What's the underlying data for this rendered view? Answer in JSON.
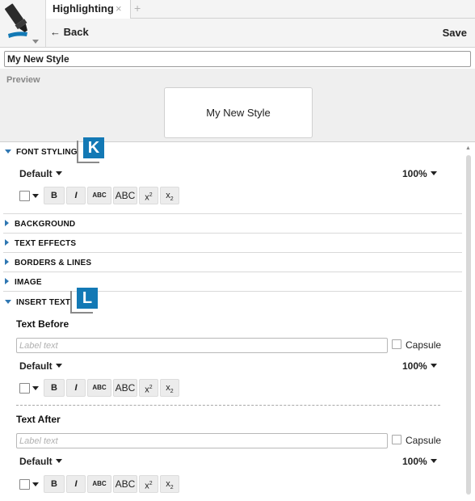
{
  "tabs": [
    {
      "label": "Highlighting",
      "close_glyph": "×"
    }
  ],
  "add_tab_glyph": "+",
  "toolbar": {
    "back_label": "Back",
    "back_glyph": "←",
    "save_label": "Save"
  },
  "style_name": "My New Style",
  "preview": {
    "label": "Preview",
    "text": "My New Style"
  },
  "sections": {
    "font_styling": "FONT STYLING",
    "background": "BACKGROUND",
    "text_effects": "TEXT EFFECTS",
    "borders_lines": "BORDERS & LINES",
    "image": "IMAGE",
    "insert_text": "INSERT TEXT"
  },
  "badges": {
    "k": "K",
    "l": "L"
  },
  "font_row": {
    "font": "Default",
    "size": "100%"
  },
  "format_buttons": {
    "bold": "B",
    "italic": "I",
    "small_caps": "ABC",
    "all_caps": "ABC",
    "superscript_base": "x",
    "superscript_exp": "2",
    "subscript_base": "x",
    "subscript_exp": "2"
  },
  "insert_text": {
    "before_title": "Text Before",
    "after_title": "Text After",
    "placeholder": "Label text",
    "capsule_label": "Capsule"
  },
  "colors": {
    "accent": "#1379b5",
    "section_arrow": "#2f77b2"
  },
  "icons": {
    "logo": "highlighter-marker-icon",
    "back": "arrow-left-icon",
    "close": "close-icon",
    "add": "plus-icon"
  }
}
